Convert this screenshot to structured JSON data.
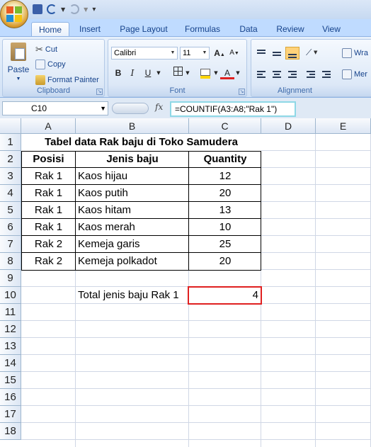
{
  "tabs": [
    "Home",
    "Insert",
    "Page Layout",
    "Formulas",
    "Data",
    "Review",
    "View"
  ],
  "clipboard": {
    "paste": "Paste",
    "cut": "Cut",
    "copy": "Copy",
    "format_painter": "Format Painter",
    "label": "Clipboard"
  },
  "font": {
    "name": "Calibri",
    "size": "11",
    "label": "Font",
    "bold": "B",
    "italic": "I",
    "underline": "U"
  },
  "alignment": {
    "label": "Alignment",
    "wrap": "Wra",
    "merge": "Mer"
  },
  "formula_bar": {
    "name_box": "C10",
    "fx": "fx",
    "formula": "=COUNTIF(A3:A8;\"Rak 1\")"
  },
  "columns": [
    "A",
    "B",
    "C",
    "D",
    "E"
  ],
  "rows": [
    "1",
    "2",
    "3",
    "4",
    "5",
    "6",
    "7",
    "8",
    "9",
    "10",
    "11",
    "12",
    "13",
    "14",
    "15",
    "16",
    "17",
    "18"
  ],
  "sheet": {
    "title": "Tabel data Rak baju di Toko Samudera",
    "headers": [
      "Posisi",
      "Jenis baju",
      "Quantity"
    ],
    "data": [
      [
        "Rak 1",
        "Kaos hijau",
        "12"
      ],
      [
        "Rak 1",
        "Kaos putih",
        "20"
      ],
      [
        "Rak 1",
        "Kaos hitam",
        "13"
      ],
      [
        "Rak 1",
        "Kaos merah",
        "10"
      ],
      [
        "Rak 2",
        "Kemeja garis",
        "25"
      ],
      [
        "Rak 2",
        "Kemeja polkadot",
        "20"
      ]
    ],
    "total_label": "Total jenis baju Rak 1",
    "total_value": "4"
  },
  "colors": {
    "selection": "#e02020",
    "ribbon": "#d2e2f6",
    "tab_bar": "#bfdbff"
  }
}
